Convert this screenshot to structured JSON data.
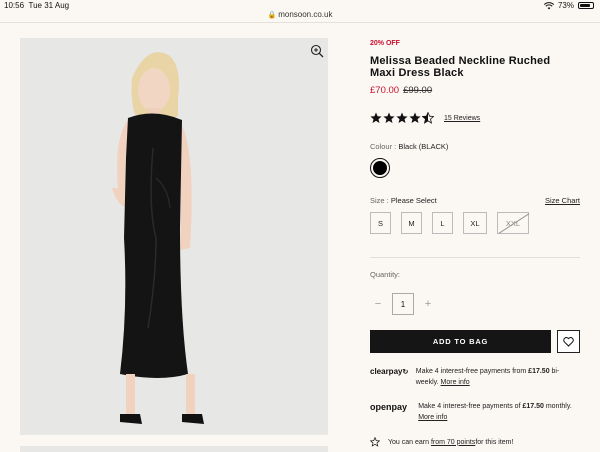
{
  "status_bar": {
    "time": "10:56",
    "date": "Tue 31 Aug",
    "battery": "73%"
  },
  "url": "monsoon.co.uk",
  "product": {
    "discount": "20% OFF",
    "title": "Melissa Beaded Neckline Ruched Maxi Dress Black",
    "price_now": "£70.00",
    "price_was": "£99.00",
    "rating": 4.5,
    "reviews": "15 Reviews",
    "colour_label": "Colour :",
    "colour_value": "Black (BLACK)",
    "size_label": "Size :",
    "size_value": "Please Select",
    "size_chart": "Size Chart",
    "sizes": [
      "S",
      "M",
      "L",
      "XL",
      "XXL"
    ],
    "quantity_label": "Quantity:",
    "quantity": "1",
    "add_to_bag": "ADD TO BAG"
  },
  "clearpay": {
    "logo": "clearpay",
    "text_before": "Make 4 interest-free payments from ",
    "amount": "£17.50",
    "text_after": " bi-weekly. ",
    "link": "More info"
  },
  "openpay": {
    "logo": "openpay",
    "text_before": "Make 4 interest-free payments of ",
    "amount": "£17.50",
    "text_after": " monthly. ",
    "link": "More info"
  },
  "points": {
    "before": "You can earn ",
    "link": "from 70 points",
    "after": " for this item!"
  },
  "colors": {
    "accent_red": "#c8102e",
    "button_dark": "#151515",
    "image_bg": "#e7e7e5"
  }
}
